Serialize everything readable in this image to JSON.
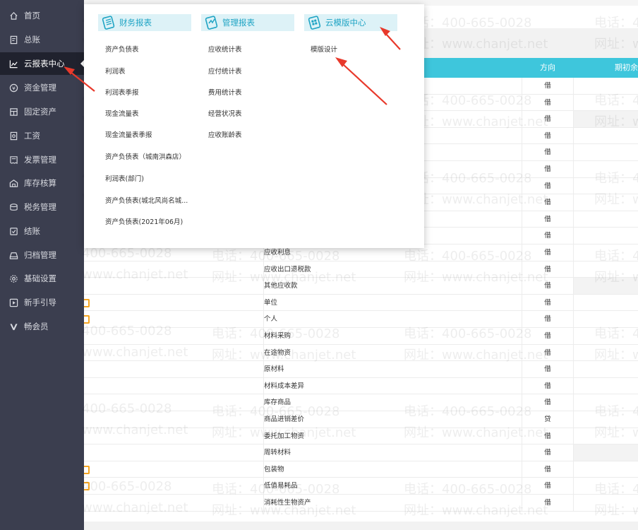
{
  "sidebar": {
    "items": [
      {
        "label": "首页",
        "icon": "home-icon"
      },
      {
        "label": "总账",
        "icon": "ledger-icon"
      },
      {
        "label": "云报表中心",
        "icon": "chart-icon"
      },
      {
        "label": "资金管理",
        "icon": "fund-icon"
      },
      {
        "label": "固定资产",
        "icon": "asset-icon"
      },
      {
        "label": "工资",
        "icon": "salary-icon"
      },
      {
        "label": "发票管理",
        "icon": "invoice-icon"
      },
      {
        "label": "库存核算",
        "icon": "inventory-icon"
      },
      {
        "label": "税务管理",
        "icon": "tax-icon"
      },
      {
        "label": "结账",
        "icon": "closing-icon"
      },
      {
        "label": "归档管理",
        "icon": "archive-icon"
      },
      {
        "label": "基础设置",
        "icon": "gear-icon"
      },
      {
        "label": "新手引导",
        "icon": "guide-icon"
      },
      {
        "label": "畅会员",
        "icon": "vip-icon"
      }
    ]
  },
  "dropdown": {
    "columns": [
      {
        "title": "财务报表",
        "icon": "finance-report-icon",
        "items": [
          "资产负债表",
          "利润表",
          "利润表季报",
          "现金流量表",
          "现金流量表季报",
          "资产负债表（城南洪森店）",
          "利润表(部门)",
          "资产负债表(城北风尚名城...",
          "资产负债表(2021年06月)"
        ]
      },
      {
        "title": "管理报表",
        "icon": "management-report-icon",
        "items": [
          "应收统计表",
          "应付统计表",
          "费用统计表",
          "经营状况表",
          "应收账龄表"
        ]
      },
      {
        "title": "云模版中心",
        "icon": "cloud-template-icon",
        "items": [
          "模版设计"
        ]
      }
    ]
  },
  "table": {
    "headers": {
      "direction": "方向",
      "opening": "期初余"
    },
    "rows": [
      {
        "name": "",
        "dir": "借"
      },
      {
        "name": "",
        "dir": "借"
      },
      {
        "name": "",
        "dir": "借"
      },
      {
        "name": "",
        "dir": "借"
      },
      {
        "name": "",
        "dir": "借"
      },
      {
        "name": "",
        "dir": "借"
      },
      {
        "name": "",
        "dir": "借"
      },
      {
        "name": "",
        "dir": "借"
      },
      {
        "name": "",
        "dir": "借"
      },
      {
        "name": "",
        "dir": "借"
      },
      {
        "name": "应收利息",
        "dir": "借"
      },
      {
        "name": "应收出口退税款",
        "dir": "借"
      },
      {
        "name": "其他应收款",
        "dir": "借"
      },
      {
        "name": "单位",
        "dir": "借"
      },
      {
        "name": "个人",
        "dir": "借"
      },
      {
        "name": "材料采购",
        "dir": "借"
      },
      {
        "name": "在途物资",
        "dir": "借"
      },
      {
        "name": "原材料",
        "dir": "借"
      },
      {
        "name": "材料成本差异",
        "dir": "借"
      },
      {
        "name": "库存商品",
        "dir": "借"
      },
      {
        "name": "商品进销差价",
        "dir": "贷"
      },
      {
        "name": "委托加工物资",
        "dir": "借"
      },
      {
        "name": "周转材料",
        "dir": "借"
      },
      {
        "name": "包装物",
        "dir": "借"
      },
      {
        "name": "低值易耗品",
        "dir": "借"
      },
      {
        "name": "消耗性生物资产",
        "dir": "借"
      }
    ]
  },
  "watermark": {
    "phone": "电话：400-665-0028",
    "phone_partial": "400-665-0028",
    "url": "网址：www.chanjet.net",
    "url_partial": "www.chanjet.net"
  },
  "colors": {
    "sidebar_bg": "#3b3e4f",
    "sidebar_active": "#20222e",
    "header_teal": "#3ec6dc",
    "menu_head_text": "#1fa4c4",
    "arrow_red": "#e8392b",
    "badge_orange": "#f5a623"
  }
}
